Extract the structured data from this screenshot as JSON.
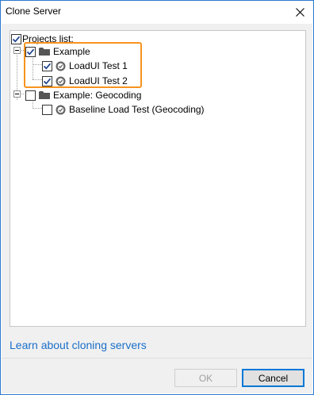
{
  "window": {
    "title": "Clone Server"
  },
  "tree": {
    "root": {
      "label": "Projects list:",
      "checked": true
    },
    "projects": [
      {
        "label": "Example",
        "checked": true,
        "expanded": true,
        "tests": [
          {
            "label": "LoadUI Test 1",
            "checked": true
          },
          {
            "label": "LoadUI Test 2",
            "checked": true
          }
        ]
      },
      {
        "label": "Example: Geocoding",
        "checked": false,
        "expanded": true,
        "tests": [
          {
            "label": "Baseline Load Test (Geocoding)",
            "checked": false
          }
        ]
      }
    ]
  },
  "link": {
    "text": "Learn about cloning servers"
  },
  "buttons": {
    "ok": "OK",
    "cancel": "Cancel"
  },
  "colors": {
    "accent": "#0078d7",
    "highlight": "#f7941d",
    "link": "#1a6fc9"
  }
}
